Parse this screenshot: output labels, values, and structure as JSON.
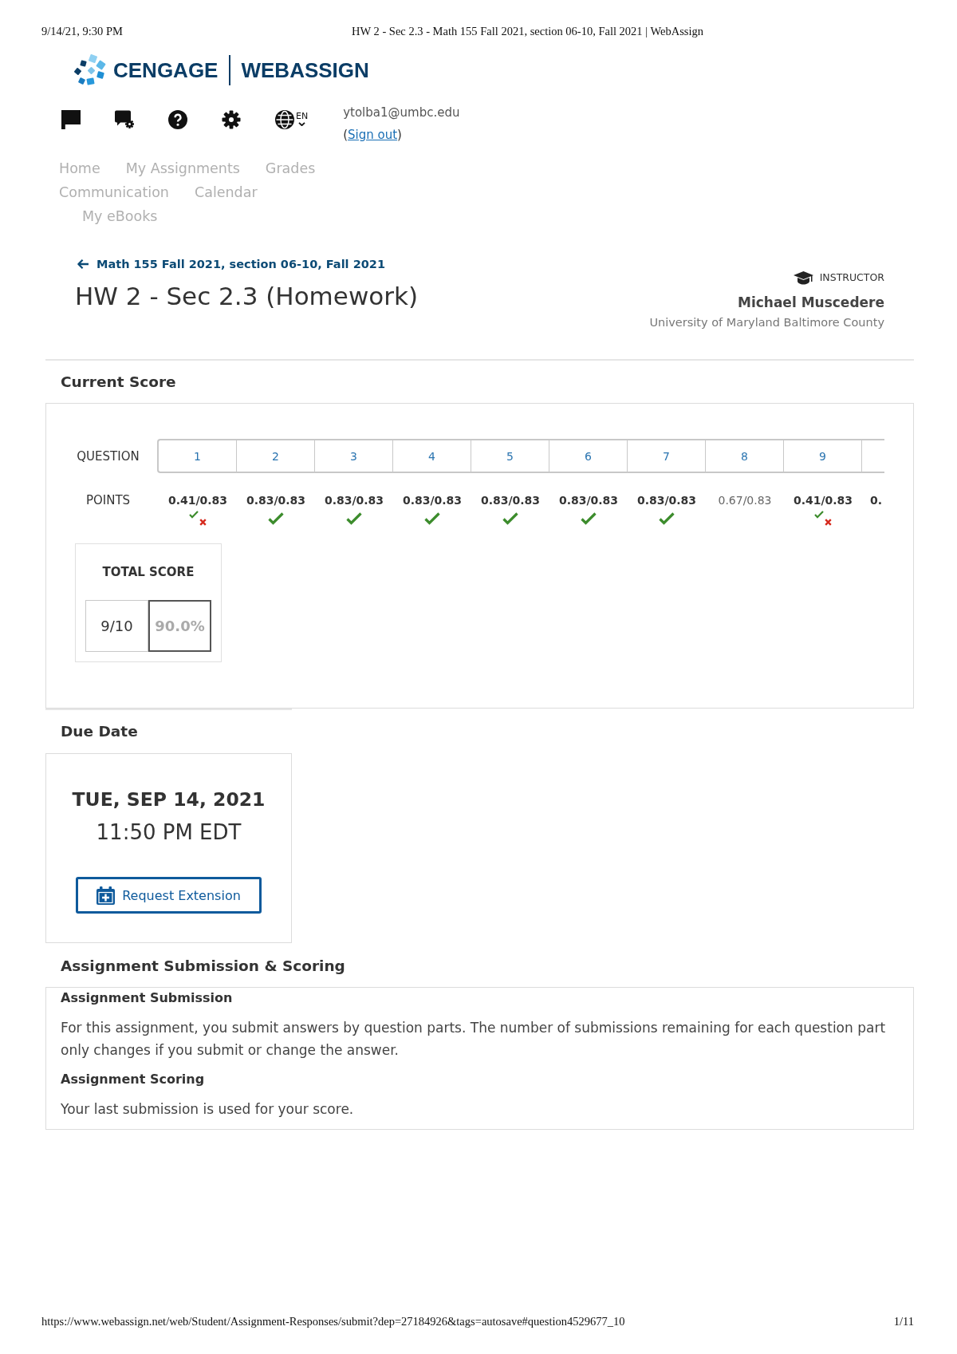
{
  "print_header": {
    "date": "9/14/21, 9:30 PM",
    "title": "HW 2 - Sec 2.3 - Math 155 Fall 2021, section 06-10, Fall 2021 | WebAssign"
  },
  "logo": {
    "brand": "CENGAGE",
    "product": "WEBASSIGN"
  },
  "language": "EN",
  "account": {
    "email": "ytolba1@umbc.edu",
    "sign_out": {
      "prefix": "(",
      "link": "Sign out",
      "suffix": ")"
    }
  },
  "nav": [
    "Home",
    "My Assignments",
    "Grades",
    "Communication",
    "Calendar",
    "My eBooks"
  ],
  "course_link": "Math 155 Fall 2021, section 06-10, Fall 2021",
  "title": "HW 2 - Sec 2.3 (Homework)",
  "instructor": {
    "role": "INSTRUCTOR",
    "name": "Michael Muscedere",
    "school": "University of Maryland Baltimore County"
  },
  "current_score": {
    "title": "Current Score",
    "question_label": "QUESTION",
    "points_label": "POINTS",
    "questions": [
      {
        "number": "1",
        "points": "0.41/0.83",
        "bold": true,
        "check": true,
        "cross": true,
        "cut_off": false
      },
      {
        "number": "2",
        "points": "0.83/0.83",
        "bold": true,
        "check": true,
        "cross": false,
        "cut_off": false
      },
      {
        "number": "3",
        "points": "0.83/0.83",
        "bold": true,
        "check": true,
        "cross": false,
        "cut_off": false
      },
      {
        "number": "4",
        "points": "0.83/0.83",
        "bold": true,
        "check": true,
        "cross": false,
        "cut_off": false
      },
      {
        "number": "5",
        "points": "0.83/0.83",
        "bold": true,
        "check": true,
        "cross": false,
        "cut_off": false
      },
      {
        "number": "6",
        "points": "0.83/0.83",
        "bold": true,
        "check": true,
        "cross": false,
        "cut_off": false
      },
      {
        "number": "7",
        "points": "0.83/0.83",
        "bold": true,
        "check": true,
        "cross": false,
        "cut_off": false
      },
      {
        "number": "8",
        "points": "0.67/0.83",
        "bold": false,
        "check": false,
        "cross": false,
        "cut_off": false
      },
      {
        "number": "9",
        "points": "0.41/0.83",
        "bold": true,
        "check": true,
        "cross": true,
        "cut_off": false
      },
      {
        "points": "0.",
        "bold": true,
        "check": false,
        "cross": false,
        "cut_off": true
      }
    ],
    "total": {
      "label": "TOTAL SCORE",
      "values": [
        {
          "text": "9/10",
          "selected": false
        },
        {
          "text": "90.0%",
          "selected": true
        }
      ]
    }
  },
  "due_date": {
    "title": "Due Date",
    "date": "TUE, SEP 14, 2021",
    "time": "11:50 PM EDT",
    "button": "Request Extension"
  },
  "submission": {
    "title": "Assignment Submission & Scoring",
    "blocks": [
      {
        "heading": "Assignment Submission",
        "text": "For this assignment, you submit answers by question parts. The number of submissions remaining for each question part only changes if you submit or change the answer."
      },
      {
        "heading": "Assignment Scoring",
        "text": "Your last submission is used for your score."
      }
    ]
  },
  "print_footer": {
    "url": "https://www.webassign.net/web/Student/Assignment-Responses/submit?dep=27184926&tags=autosave#question4529677_10",
    "page": "1/11"
  }
}
